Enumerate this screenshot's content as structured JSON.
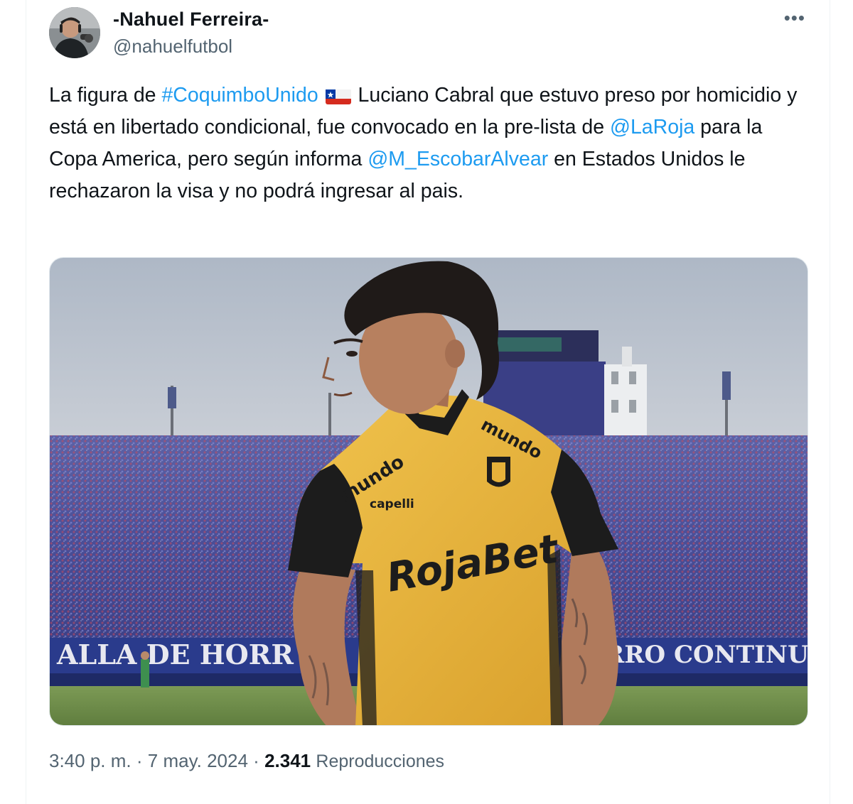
{
  "tweet": {
    "author_name": "-Nahuel Ferreira-",
    "author_handle": "@nahuelfutbol",
    "more_icon": "more-horizontal-icon",
    "text_parts": {
      "p1": "La figura de ",
      "hashtag": "#CoquimboUnido",
      "p2": " Luciano Cabral que estuvo preso por homicidio y está en libertado condicional, fue convocado en la pre-lista de ",
      "mention1": "@LaRoja",
      "p3": " para la Copa America, pero según informa ",
      "mention2": "@M_EscobarAlvear",
      "p4": " en Estados Unidos le rechazaron la visa y no podrá ingresar al pais."
    },
    "flag_icon": "chile-flag-icon",
    "media": {
      "jersey_sponsor_top": "mundo",
      "jersey_brand": "capelli",
      "jersey_sponsor_main": "RojaBet",
      "banner_left": "ALLA DE HORR",
      "banner_right": "RRO CONTINUA"
    },
    "time": "3:40 p. m.",
    "separator": "·",
    "date": "7 may. 2024",
    "views_count": "2.341",
    "views_label": "Reproducciones"
  },
  "colors": {
    "link": "#1d9bf0",
    "text": "#0f1419",
    "secondary": "#536471",
    "jersey": "#e6b13a"
  }
}
